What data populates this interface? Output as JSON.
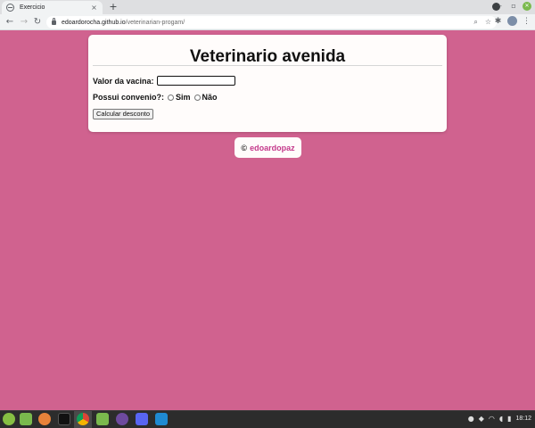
{
  "browser": {
    "tab_title": "Exercicio",
    "tab_close": "×",
    "new_tab": "+",
    "url_host": "edoardorocha.github.io",
    "url_path": "/veterinarian-progam/",
    "back": "←",
    "forward": "→",
    "reload": "↻",
    "win_minimize": "–",
    "win_maximize": "▫",
    "win_close": "✕",
    "zoom_icon": "⌕",
    "star_icon": "☆",
    "extensions_icon": "✱",
    "menu_icon": "⋮"
  },
  "page": {
    "title": "Veterinario avenida",
    "vaccine_label": "Valor da vacina:",
    "vaccine_value": "",
    "convenio_label": "Possui convenio?:",
    "option_yes": "Sim",
    "option_no": "Não",
    "calculate_button": "Calcular desconto",
    "footer_copyright": "©",
    "footer_author": "edoardopaz"
  },
  "taskbar": {
    "clock": "18:12",
    "tray_icons": [
      "discord-icon",
      "shield-icon",
      "wifi-icon",
      "volume-icon",
      "battery-icon"
    ]
  },
  "colors": {
    "background": "#d0628f",
    "card": "#fffcfb",
    "link": "#c4388a"
  }
}
